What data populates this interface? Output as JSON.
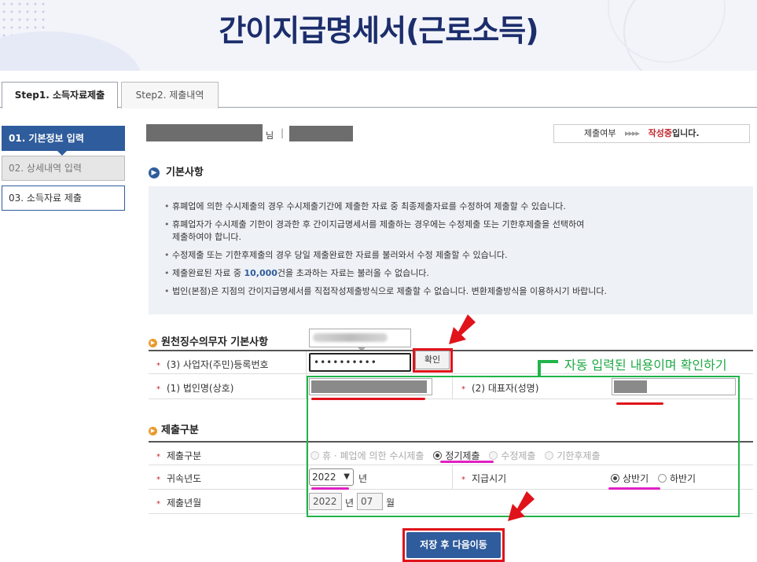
{
  "header": {
    "title": "간이지급명세서(근로소득)"
  },
  "tabs": [
    {
      "label": "Step1. 소득자료제출"
    },
    {
      "label": "Step2. 제출내역"
    }
  ],
  "steps": [
    {
      "label": "01. 기본정보 입력"
    },
    {
      "label": "02. 상세내역 입력"
    },
    {
      "label": "03. 소득자료 제출"
    }
  ],
  "userbar": {
    "honorific": "님",
    "separator": "|",
    "status_label": "제출여부",
    "status_arrows": "▸▸▸▸",
    "status_value": "작성중",
    "status_suffix": "입니다."
  },
  "basic": {
    "title": "기본사항",
    "notices": [
      "휴폐업에 의한 수시제출의 경우 수시제출기간에 제출한 자료 중 최종제출자료를 수정하여 제출할 수 있습니다.",
      "휴폐업자가 수시제출 기한이 경과한 후 간이지급명세서를 제출하는 경우에는 수정제출 또는 기한후제출을 선택하여",
      "제출하여야 합니다.",
      "수정제출 또는 기한후제출의 경우 당일 제출완료한 자료를 불러와서 수정 제출할 수 있습니다.",
      "제출완료된 자료 중 ",
      "10,000",
      "건을 초과하는 자료는 불러올 수 없습니다.",
      "법인(본점)은 지점의 간이지급명세서를 직접작성제출방식으로 제출할 수 없습니다. 변환제출방식을 이용하시기 바랍니다."
    ]
  },
  "withholder": {
    "title": "원천징수의무자 기본사항",
    "reg_label": "(3) 사업자(주민)등록번호",
    "reg_value": "••••••••••",
    "confirm_label": "확인",
    "corp_label": "(1) 법인명(상호)",
    "rep_label": "(2) 대표자(성명)"
  },
  "submission": {
    "title": "제출구분",
    "type_label": "제출구분",
    "options": [
      {
        "label": "휴 · 폐업에 의한 수시제출",
        "state": "disabled"
      },
      {
        "label": "정기제출",
        "state": "checked"
      },
      {
        "label": "수정제출",
        "state": "disabled"
      },
      {
        "label": "기한후제출",
        "state": "disabled"
      }
    ],
    "year_label": "귀속년도",
    "year_value": "2022",
    "year_unit": "년",
    "pay_period_label": "지급시기",
    "pay_options": [
      {
        "label": "상반기",
        "state": "checked"
      },
      {
        "label": "하반기",
        "state": "unchecked"
      }
    ],
    "month_label": "제출년월",
    "month_year": "2022",
    "month_year_unit": "년",
    "month_value": "07",
    "month_unit": "월"
  },
  "annotation": {
    "text": "자동 입력된 내용이며 확인하기"
  },
  "save_button": "저장 후 다음이동",
  "colors": {
    "primary": "#2f5c9c",
    "accent_red": "#e0121a",
    "annotation_green": "#20b44a",
    "highlight_pink": "#e020c4"
  }
}
